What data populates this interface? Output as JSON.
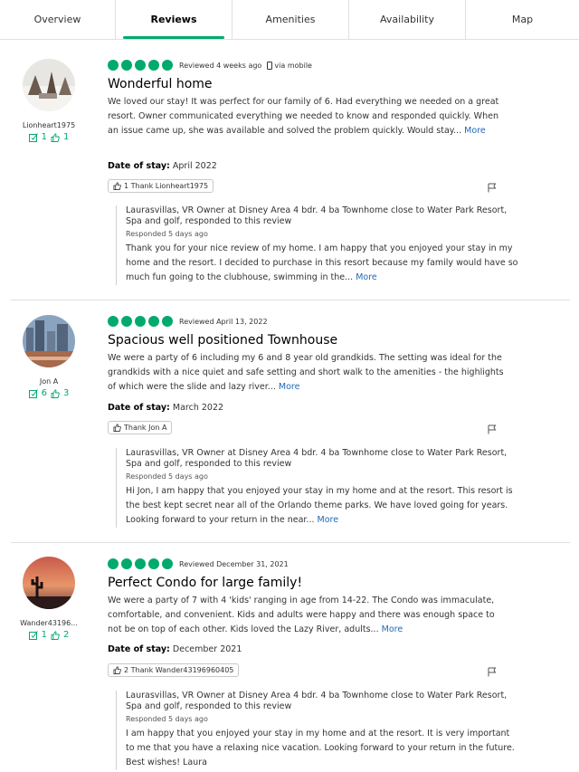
{
  "tabs": [
    {
      "label": "Overview"
    },
    {
      "label": "Reviews",
      "active": true
    },
    {
      "label": "Amenities"
    },
    {
      "label": "Availability"
    },
    {
      "label": "Map"
    }
  ],
  "reviews": [
    {
      "username": "Lionheart1975",
      "contributions": "1",
      "helpful": "1",
      "bubbles": 5,
      "meta": "Reviewed 4 weeks ago",
      "device": "via mobile",
      "title": "Wonderful home",
      "body": "We loved our stay! It was perfect for our family of 6. Had everything we needed on a great resort. Owner communicated everything we needed to know and responded quickly. When an issue came up, she was available and solved the problem quickly. Would stay...",
      "more": "More",
      "stay_label": "Date of stay:",
      "stay_value": "April 2022",
      "thank": "1  Thank Lionheart1975",
      "response": {
        "title": "Laurasvillas, VR Owner at Disney Area 4 bdr. 4 ba Townhome close to Water Park Resort, Spa and golf, responded to this review",
        "date": "Responded 5 days ago",
        "body": "Thank you for your nice review of my home. I am happy that you enjoyed your stay in my home and the resort. I decided to purchase in this resort because my family would have so much fun going to the clubhouse, swimming in the...",
        "more": "More"
      }
    },
    {
      "username": "Jon A",
      "contributions": "6",
      "helpful": "3",
      "bubbles": 5,
      "meta": "Reviewed April 13, 2022",
      "device": "",
      "title": "Spacious well positioned Townhouse",
      "body": "We were a party of 6 including my 6 and 8 year old grandkids. The setting was ideal for the grandkids with a nice quiet and safe setting and short walk to the amenities - the highlights of which were the slide and lazy river...",
      "more": "More",
      "stay_label": "Date of stay:",
      "stay_value": "March 2022",
      "thank": "Thank Jon A",
      "response": {
        "title": "Laurasvillas, VR Owner at Disney Area 4 bdr. 4 ba Townhome close to Water Park Resort, Spa and golf, responded to this review",
        "date": "Responded 5 days ago",
        "body": "Hi Jon, I am happy that you enjoyed your stay in my home and at the resort. This resort is the best kept secret near all of the Orlando theme parks. We have loved going for years. Looking forward to your return in the near...",
        "more": "More"
      }
    },
    {
      "username": "Wander43196...",
      "contributions": "1",
      "helpful": "2",
      "bubbles": 5,
      "meta": "Reviewed December 31, 2021",
      "device": "",
      "title": "Perfect Condo for large family!",
      "body": "We were a party of 7 with 4 'kids' ranging in age from 14-22. The Condo was immaculate, comfortable, and convenient. Kids and adults were happy and there was enough space to not be on top of each other. Kids loved the Lazy River, adults...",
      "more": "More",
      "stay_label": "Date of stay:",
      "stay_value": "December 2021",
      "thank": "2  Thank Wander43196960405",
      "response": {
        "title": "Laurasvillas, VR Owner at Disney Area 4 bdr. 4 ba Townhome close to Water Park Resort, Spa and golf, responded to this review",
        "date": "Responded 5 days ago",
        "body": "I am happy that you enjoyed your stay in my home and at the resort. It is very important to me that you have a relaxing nice vacation. Looking forward to your return in the future. Best wishes! Laura",
        "more": ""
      }
    }
  ]
}
